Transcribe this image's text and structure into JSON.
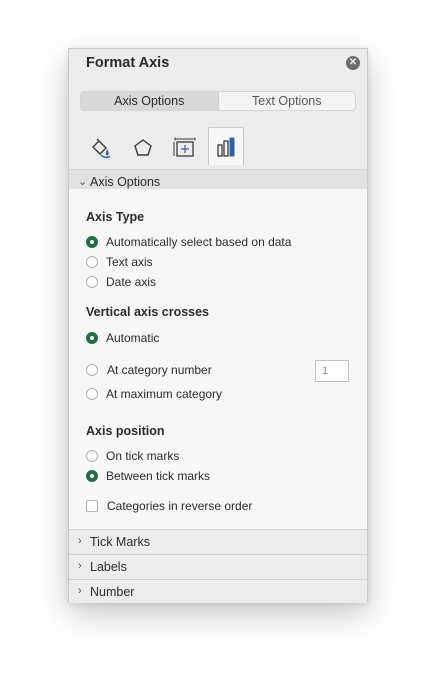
{
  "panel": {
    "title": "Format Axis",
    "close_icon": "close-icon"
  },
  "segments": [
    {
      "label": "Axis Options",
      "active": true
    },
    {
      "label": "Text Options",
      "active": false
    }
  ],
  "icon_tabs": [
    {
      "icon": "fill-line-icon",
      "selected": false
    },
    {
      "icon": "effects-pentagon-icon",
      "selected": false
    },
    {
      "icon": "size-properties-icon",
      "selected": false
    },
    {
      "icon": "axis-options-chart-icon",
      "selected": true
    }
  ],
  "axis_options_section": {
    "label": "Axis Options",
    "expanded": true,
    "axis_type": {
      "title": "Axis Type",
      "options": [
        {
          "label": "Automatically select based on data",
          "checked": true
        },
        {
          "label": "Text axis",
          "checked": false
        },
        {
          "label": "Date axis",
          "checked": false
        }
      ]
    },
    "vertical_axis_crosses": {
      "title": "Vertical axis crosses",
      "options": [
        {
          "label": "Automatic",
          "checked": true
        },
        {
          "label": "At category number",
          "checked": false
        },
        {
          "label": "At maximum category",
          "checked": false
        }
      ],
      "category_number_value": "1"
    },
    "axis_position": {
      "title": "Axis position",
      "options": [
        {
          "label": "On tick marks",
          "checked": false
        },
        {
          "label": "Between tick marks",
          "checked": true
        }
      ]
    },
    "reverse_order": {
      "label": "Categories in reverse order",
      "checked": false
    }
  },
  "collapsed_sections": [
    {
      "label": "Tick Marks"
    },
    {
      "label": "Labels"
    },
    {
      "label": "Number"
    }
  ],
  "colors": {
    "accent_radio": "#1e7145",
    "panel_bg": "#ececec",
    "content_bg": "#f7f7f7"
  }
}
